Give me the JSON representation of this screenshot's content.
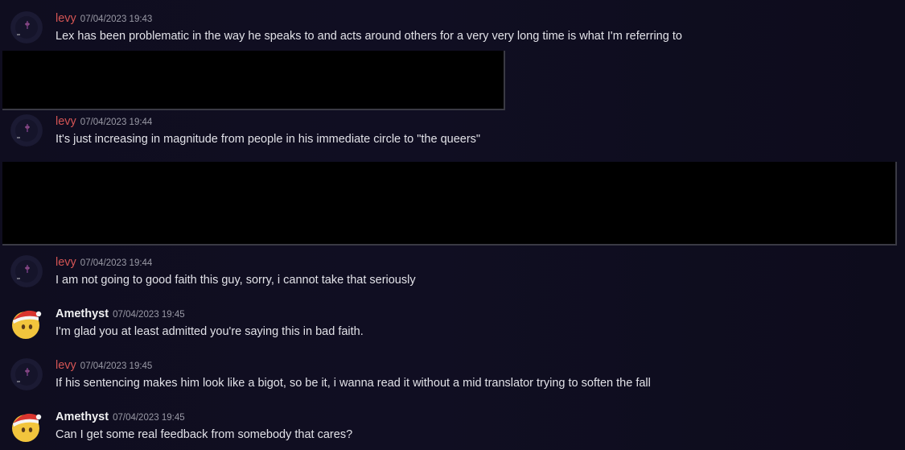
{
  "messages": [
    {
      "author": "levy",
      "timestamp": "07/04/2023 19:43",
      "text": "Lex has been problematic in the way he speaks to and acts around others for a very very long time is what I'm referring to",
      "avatar_icon": "levy-dark-avatar-icon"
    },
    {
      "author": "levy",
      "timestamp": "07/04/2023 19:44",
      "text": "It's just increasing in magnitude from people in his immediate circle to \"the queers\"",
      "avatar_icon": "levy-dark-avatar-icon"
    },
    {
      "author": "levy",
      "timestamp": "07/04/2023 19:44",
      "text": "I am not going to good faith this guy, sorry, i cannot take that seriously",
      "avatar_icon": "levy-dark-avatar-icon"
    },
    {
      "author": "Amethyst",
      "timestamp": "07/04/2023 19:45",
      "text": "I'm glad you at least admitted you're saying this in bad faith.",
      "avatar_icon": "santa-hat-emoji-avatar-icon"
    },
    {
      "author": "levy",
      "timestamp": "07/04/2023 19:45",
      "text": "If his sentencing makes him look like a bigot, so be it, i wanna read it without a mid translator trying to soften the fall",
      "avatar_icon": "levy-dark-avatar-icon"
    },
    {
      "author": "Amethyst",
      "timestamp": "07/04/2023 19:45",
      "text": "Can I get some real feedback from somebody that cares?",
      "avatar_icon": "santa-hat-emoji-avatar-icon"
    }
  ],
  "colors": {
    "background": "#0f0d1f",
    "levy_name": "#d35454",
    "amethyst_name": "#f0f0f2",
    "text": "#e2e2e8",
    "timestamp": "#9a9aa6",
    "redaction": "#000000"
  }
}
